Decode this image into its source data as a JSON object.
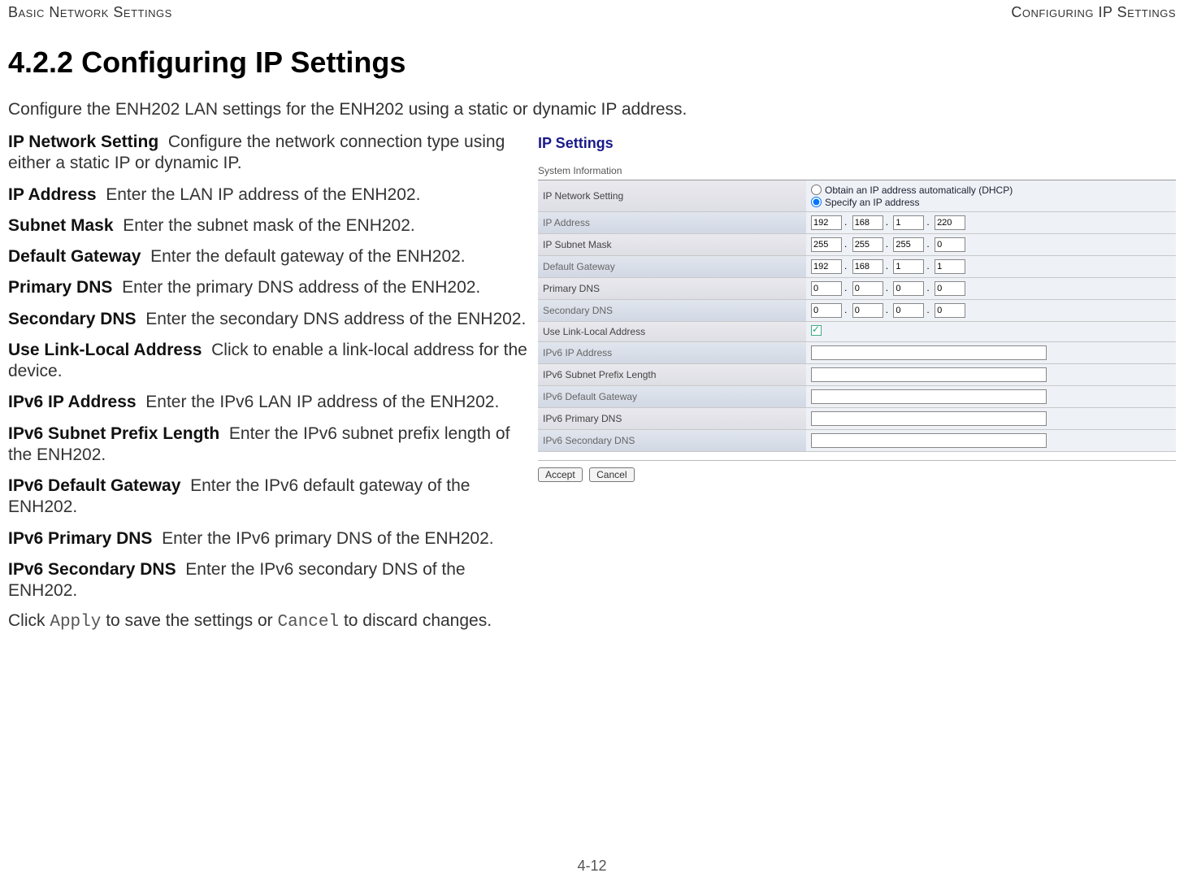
{
  "header": {
    "left": "Basic Network Settings",
    "right": "Configuring IP Settings"
  },
  "title": "4.2.2 Configuring IP Settings",
  "intro": "Configure the ENH202 LAN settings for the ENH202 using a static or dynamic IP address.",
  "defs": [
    {
      "term": "IP Network Setting",
      "desc": "Configure the network connection type using either a static IP or dynamic IP."
    },
    {
      "term": "IP Address",
      "desc": "Enter the LAN IP address of the ENH202."
    },
    {
      "term": "Subnet Mask",
      "desc": "Enter the subnet mask of the ENH202."
    },
    {
      "term": "Default Gateway",
      "desc": "Enter the default gateway of the ENH202."
    },
    {
      "term": "Primary DNS",
      "desc": "Enter the primary DNS address of the ENH202."
    },
    {
      "term": "Secondary DNS",
      "desc": "Enter the secondary DNS address of the ENH202."
    },
    {
      "term": "Use Link-Local Address",
      "desc": "Click to enable a link-local address for the device."
    },
    {
      "term": "IPv6 IP Address",
      "desc": "Enter the IPv6 LAN IP address of the ENH202."
    },
    {
      "term": "IPv6 Subnet Prefix Length",
      "desc": "Enter the IPv6 subnet prefix length of the ENH202."
    },
    {
      "term": "IPv6 Default Gateway",
      "desc": "Enter the IPv6 default gateway of the ENH202."
    },
    {
      "term": "IPv6 Primary DNS",
      "desc": "Enter the IPv6 primary DNS of the ENH202."
    },
    {
      "term": "IPv6 Secondary DNS",
      "desc": "Enter the IPv6 secondary DNS of the ENH202."
    }
  ],
  "footnote": {
    "pre": "Click ",
    "code1": "Apply",
    "mid": " to save the settings or ",
    "code2": "Cancel",
    "post": " to discard changes."
  },
  "panel": {
    "title": "IP Settings",
    "sysinfo": "System Information",
    "labels": {
      "ipnet": "IP Network Setting",
      "ipaddr": "IP Address",
      "subnet": "IP Subnet Mask",
      "gateway": "Default Gateway",
      "pdns": "Primary DNS",
      "sdns": "Secondary DNS",
      "linklocal": "Use Link-Local Address",
      "v6ip": "IPv6 IP Address",
      "v6prefix": "IPv6 Subnet Prefix Length",
      "v6gw": "IPv6 Default Gateway",
      "v6pdns": "IPv6 Primary DNS",
      "v6sdns": "IPv6 Secondary DNS"
    },
    "radios": {
      "dhcp": "Obtain an IP address automatically (DHCP)",
      "static": "Specify an IP address"
    },
    "ip": {
      "a": "192",
      "b": "168",
      "c": "1",
      "d": "220"
    },
    "mask": {
      "a": "255",
      "b": "255",
      "c": "255",
      "d": "0"
    },
    "gw": {
      "a": "192",
      "b": "168",
      "c": "1",
      "d": "1"
    },
    "pdns": {
      "a": "0",
      "b": "0",
      "c": "0",
      "d": "0"
    },
    "sdns": {
      "a": "0",
      "b": "0",
      "c": "0",
      "d": "0"
    },
    "buttons": {
      "accept": "Accept",
      "cancel": "Cancel"
    }
  },
  "pagenum": "4-12"
}
